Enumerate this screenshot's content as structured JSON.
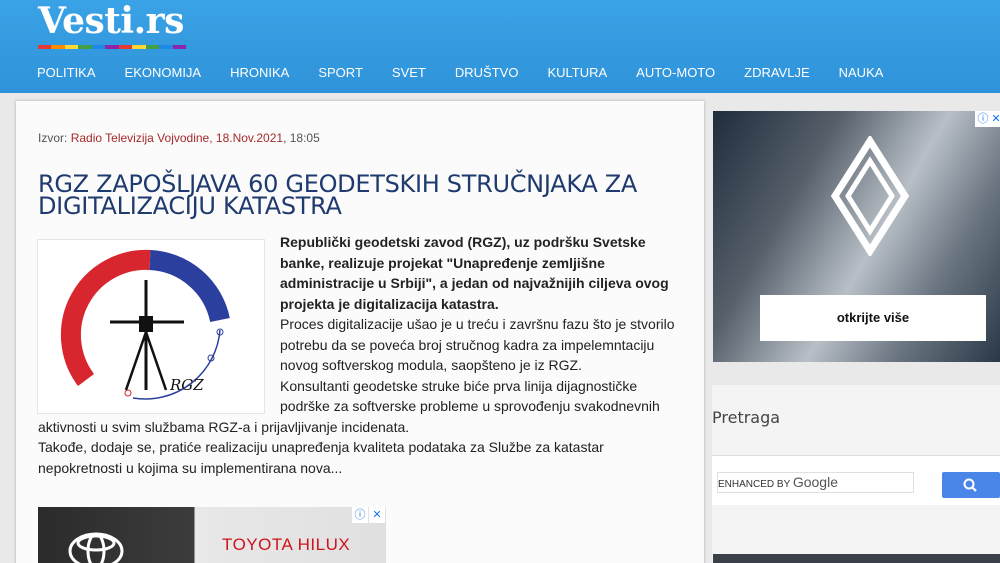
{
  "site": {
    "logo": "Vesti.rs",
    "logo_colors": [
      "#e53935",
      "#fb8c00",
      "#fdd835",
      "#43a047",
      "#1e88e5",
      "#8e24aa",
      "#e53935",
      "#fdd835",
      "#43a047",
      "#1e88e5",
      "#8e24aa"
    ]
  },
  "nav": {
    "items": [
      "POLITIKA",
      "EKONOMIJA",
      "HRONIKA",
      "SPORT",
      "SVET",
      "DRUŠTVO",
      "KULTURA",
      "AUTO-MOTO",
      "ZDRAVLJE",
      "NAUKA"
    ]
  },
  "article": {
    "source_prefix": "Izvor:",
    "source_link": "Radio Televizija Vojvodine, 18.Nov.2021",
    "source_time": ", 18:05",
    "title": "RGZ ZAPOŠLJAVA 60 GEODETSKIH STRUČNJAKA ZA DIGITALIZACIJU KATASTRA",
    "lead": "Republički geodetski zavod (RGZ), uz podršku Svetske banke, realizuje projekat \"Unapređenje zemljišne administracije u Srbiji\", a jedan od najvažnijih ciljeva ovog projekta je digitalizacija katastra.",
    "p1": "Proces digitalizacije ušao je u treću i završnu fazu što je stvorilo potrebu da se poveća broj stručnog kadra za impelemntaciju novog softverskog modula, saopšteno je iz RGZ.",
    "p2": "Konsultanti geodetske struke biće prva linija dijagnostičke podrške za softverske probleme u sprovođenju svakodnevnih aktivnosti u svim službama RGZ-a i prijavljivanje incidenata.",
    "p3": "Takođe, dodaje se, pratiće realizaciju unapređenja kvaliteta podataka za Službe za katastar nepokretnosti u kojima su implementirana nova...",
    "image_logo_text": "RGZ"
  },
  "ads": {
    "bottom_text": "TOYOTA HILUX",
    "right_cta": "otkrijte više"
  },
  "sidebar": {
    "search_title": "Pretraga",
    "search_placeholder_prefix": "ENHANCED BY",
    "search_placeholder_brand": "Google"
  },
  "colors": {
    "header": "#3aa2e6",
    "title": "#1f3a6e",
    "source_link": "#a52a2a",
    "search_button": "#4a86e8"
  }
}
